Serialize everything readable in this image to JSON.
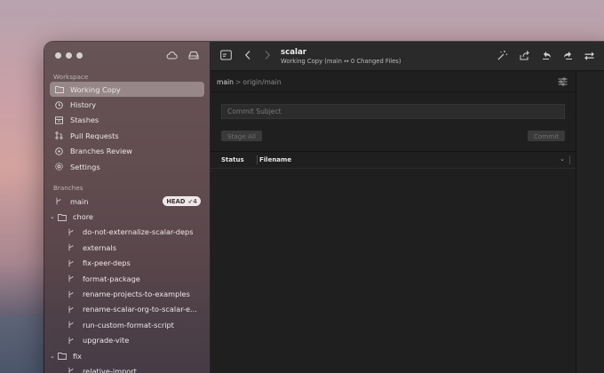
{
  "colors": {
    "accent": "#dcd2d2",
    "head_badge_bg": "#f0e8e8"
  },
  "sidebar": {
    "workspace_label": "Workspace",
    "items": [
      {
        "label": "Working Copy",
        "icon": "folder-icon",
        "selected": true
      },
      {
        "label": "History",
        "icon": "clock-icon"
      },
      {
        "label": "Stashes",
        "icon": "archive-icon"
      },
      {
        "label": "Pull Requests",
        "icon": "pull-request-icon"
      },
      {
        "label": "Branches Review",
        "icon": "eye-icon"
      },
      {
        "label": "Settings",
        "icon": "gear-icon"
      }
    ],
    "branches_label": "Branches",
    "branches": {
      "main": {
        "label": "main",
        "head_badge": "HEAD",
        "badge_count": "↙4"
      },
      "chore": {
        "label": "chore",
        "children": [
          "do-not-externalize-scalar-deps",
          "externals",
          "fix-peer-deps",
          "format-package",
          "rename-projects-to-examples",
          "rename-scalar-org-to-scalar-e...",
          "run-custom-format-script",
          "upgrade-vite"
        ]
      },
      "fix": {
        "label": "fix",
        "children": [
          "relative-import"
        ]
      }
    }
  },
  "header": {
    "title": "scalar",
    "subtitle": "Working Copy (main ↔ 0 Changed Files)"
  },
  "breadcrumb": {
    "local": "main",
    "separator": ">",
    "remote": "origin/main"
  },
  "commit": {
    "placeholder": "Commit Subject",
    "stage_all": "Stage All",
    "commit_button": "Commit"
  },
  "table": {
    "col_status": "Status",
    "col_filename": "Filename"
  }
}
